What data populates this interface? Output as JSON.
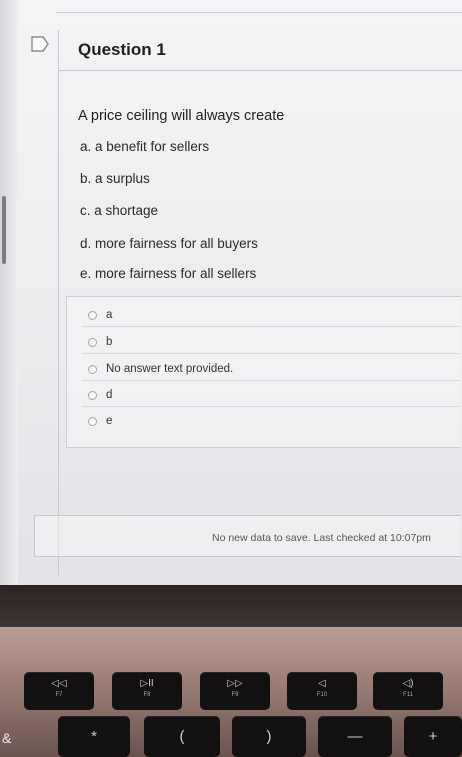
{
  "question": {
    "title": "Question 1",
    "prompt": "A price ceiling will always create",
    "choices_text": [
      "a. a benefit for sellers",
      "b. a surplus",
      "c. a shortage",
      "d. more fairness for all buyers",
      "e. more fairness for all sellers"
    ],
    "answers": [
      "a",
      "b",
      "No answer text provided.",
      "d",
      "e"
    ]
  },
  "status": {
    "message": "No new data to save. Last checked at 10:07pm"
  },
  "keyboard": {
    "fkeys": [
      {
        "glyph": "◁◁",
        "name": "F7"
      },
      {
        "glyph": "▷II",
        "name": "F8"
      },
      {
        "glyph": "▷▷",
        "name": "F9"
      },
      {
        "glyph": "◁",
        "name": "F10"
      },
      {
        "glyph": "◁)",
        "name": "F11"
      }
    ],
    "row2": [
      "*",
      "(",
      ")",
      "—",
      "+"
    ],
    "edge_symbol": "&"
  },
  "icons": {
    "flag": "flag-icon"
  }
}
